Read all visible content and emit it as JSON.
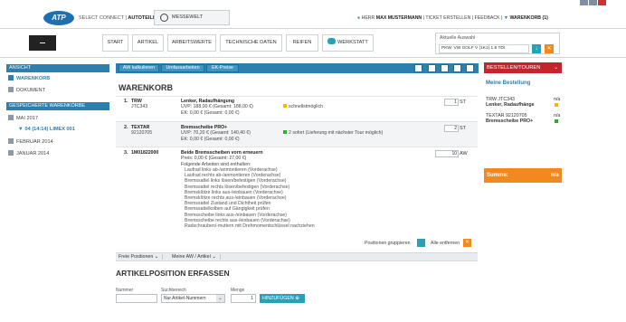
{
  "top": {
    "logo_text": "ATP",
    "select_connect": "SELECT CONNECT",
    "product": "AUTOTEILEPILOT",
    "messewelt": "MESSEWELT",
    "user_prefix": "HERR",
    "user_name": "MAX MUSTERMANN",
    "links": [
      "TICKET ERSTELLEN",
      "FEEDBACK"
    ],
    "cart_label": "WARENKORB (1)"
  },
  "nav": {
    "items": [
      "START",
      "ARTIKEL",
      "ARBEITSWERTE",
      "TECHNISCHE DATEN",
      "REIFEN",
      "WERKSTATT"
    ],
    "aktuelle_auswahl_label": "Aktuelle Auswahl",
    "vehicle": "PKW: VW GOLF V (1K1) 1.9 TDI"
  },
  "sidebar": {
    "ansicht_header": "ANSICHT",
    "ansicht_items": [
      "WARENKORB",
      "DOKUMENT"
    ],
    "saved_header": "GESPEICHERTE WARENKÖRBE",
    "saved_items": [
      "MAI 2017",
      "04 (14:14) LIMEX 001",
      "FEBRUAR 2014",
      "JANUAR 2014"
    ]
  },
  "toolbar": {
    "buttons": [
      "AW kalkulieren",
      "Umfassarbeiten",
      "EK-Preise"
    ],
    "icons": [
      "pencil-icon",
      "lock-icon",
      "save-icon",
      "print-icon",
      "mail-icon"
    ]
  },
  "warenkorb": {
    "title": "WARENKORB",
    "items": [
      {
        "num": "1.",
        "brand": "TRW",
        "article": "JTC343",
        "name": "Lenker, Radaufhängung",
        "uvp": "UVP: 188,00 € (Gesamt: 188,00 €)",
        "ek": "EK: 0,00 € (Gesamt: 0,00 €)",
        "status": "schnellstmöglich",
        "status_color": "#f5b800",
        "qty": "1",
        "unit": "ST"
      },
      {
        "num": "2.",
        "brand": "TEXTAR",
        "article": "92120705",
        "name": "Bremsscheibe PRO+",
        "uvp": "UVP: 70,20 € (Gesamt: 140,40 €)",
        "ek": "EK: 0,00 € (Gesamt: 0,00 €)",
        "status": "2 sofort (Lieferung mit nächster Tour möglich)",
        "status_color": "#2eaa3a",
        "qty": "2",
        "unit": "ST"
      },
      {
        "num": "3.",
        "brand": "1M01822000",
        "name": "Beide Bremsscheiben vorn erneuern",
        "price": "Preis: 0,00 € (Gesamt: 27,00 €)",
        "intro": "Folgende Arbeiten sind enthalten:",
        "tasks": [
          "Laufrad links ab-/anmontieren (Vorderachse)",
          "Laufrad rechts ab-/anmontieren (Vorderachse)",
          "Bremssattel links lösen/befestigen (Vorderachse)",
          "Bremssattel rechts lösen/befestigen (Vorderachse)",
          "Bremsklötze links aus-/einbauen (Vorderachse)",
          "Bremsklötze rechts aus-/einbauen (Vorderachse)",
          "Bremssattel Zustand und Dichtheit prüfen",
          "Bremssattelkolben auf Gängigkeit prüfen",
          "Bremsscheibe links aus-/einbauen (Vorderachse)",
          "Bremsscheibe rechts aus-/einbauen (Vorderachse)",
          "Radschrauben/-muttern mit Drehmomentschlüssel nachziehen"
        ],
        "qty": "10",
        "unit": "AW"
      }
    ],
    "group_label": "Positionen gruppieren",
    "remove_label": "Alle entfernen"
  },
  "freie": {
    "dropdown1": "Freie Positionen",
    "dropdown2": "Meine AW / Artikel"
  },
  "artikel": {
    "title": "ARTIKELPOSITION ERFASSEN",
    "nummer_label": "Nummer",
    "suchbereich_label": "Suchbereich",
    "suchbereich_value": "Nur Artikel-Nummern",
    "menge_label": "Menge",
    "menge_value": "1",
    "add_label": "HINZUFÜGEN"
  },
  "right": {
    "header": "BESTELLEN/TOUREN",
    "meine": "Meine Bestellung",
    "items": [
      {
        "line1": "TRW JTC343",
        "line2": "Lenker, Radaufhänge",
        "na": "n/a",
        "color": "#f5b800"
      },
      {
        "line1": "TEXTAR 92120705",
        "line2": "Bremsscheibe PRO+",
        "na": "n/a",
        "color": "#2eaa3a"
      }
    ],
    "summe_label": "Summe:",
    "summe_value": "n/a"
  },
  "colors": {
    "blue": "#2d7fae",
    "red": "#c4252a",
    "orange": "#f08a20",
    "teal": "#27a2b5"
  }
}
